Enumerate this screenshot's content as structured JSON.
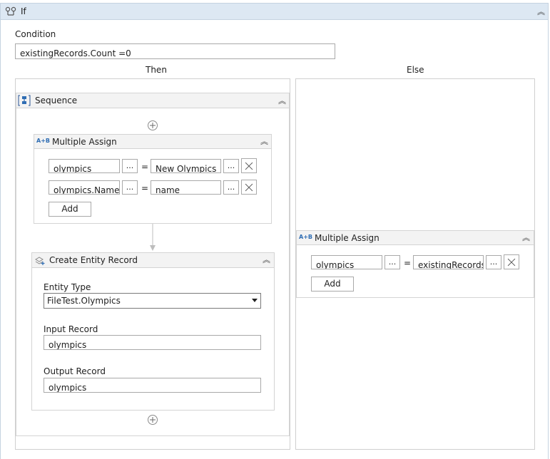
{
  "if_activity": {
    "title": "If",
    "icon": "if-activity-icon"
  },
  "condition": {
    "label": "Condition",
    "value": "existingRecords.Count =0"
  },
  "branches": {
    "then_label": "Then",
    "else_label": "Else"
  },
  "sequence": {
    "title": "Sequence",
    "icon": "sequence-icon"
  },
  "then_assign": {
    "title": "Multiple Assign",
    "icon_text": "A+B",
    "rows": [
      {
        "target": "olympics",
        "ellipsis": "...",
        "equals": "=",
        "value": "New Olympics",
        "ellipsis2": "..."
      },
      {
        "target": "olympics.Name",
        "ellipsis": "...",
        "equals": "=",
        "value": "name",
        "ellipsis2": "..."
      }
    ],
    "add_label": "Add"
  },
  "create_entity": {
    "title": "Create Entity Record",
    "icon": "create-entity-icon",
    "entity_type_label": "Entity Type",
    "entity_type_value": "FileTest.Olympics",
    "input_label": "Input Record",
    "input_value": "olympics",
    "output_label": "Output Record",
    "output_value": "olympics"
  },
  "else_assign": {
    "title": "Multiple Assign",
    "icon_text": "A+B",
    "rows": [
      {
        "target": "olympics",
        "ellipsis": "...",
        "equals": "=",
        "value": "existingRecords.l",
        "ellipsis2": "..."
      }
    ],
    "add_label": "Add"
  }
}
